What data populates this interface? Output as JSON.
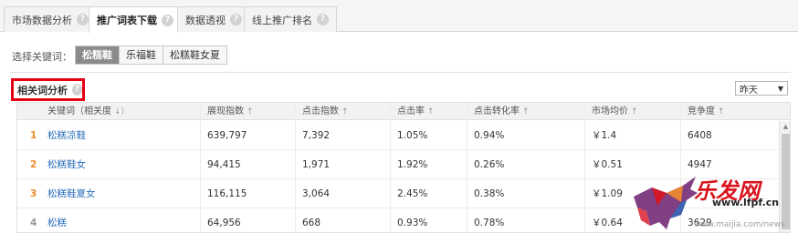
{
  "tabs": [
    {
      "label": "市场数据分析",
      "active": false
    },
    {
      "label": "推广词表下载",
      "active": true
    },
    {
      "label": "数据透视",
      "active": false
    },
    {
      "label": "线上推广排名",
      "active": false
    }
  ],
  "help_glyph": "?",
  "keyword_selector": {
    "label": "选择关键词：",
    "options": [
      "松糕鞋",
      "乐福鞋",
      "松糕鞋女夏"
    ],
    "selected": "松糕鞋"
  },
  "section": {
    "title": "相关词分析"
  },
  "date_select": {
    "value": "昨天",
    "arrow": "▼"
  },
  "table": {
    "columns": [
      {
        "label": "关键词（相关度",
        "sort": "↓）"
      },
      {
        "label": "展现指数",
        "sort": "↑"
      },
      {
        "label": "点击指数",
        "sort": "↑"
      },
      {
        "label": "点击率",
        "sort": "↑"
      },
      {
        "label": "点击转化率",
        "sort": "↑"
      },
      {
        "label": "市场均价",
        "sort": "↑"
      },
      {
        "label": "竞争度",
        "sort": "↑"
      }
    ],
    "rows": [
      {
        "rank": "1",
        "keyword": "松糕凉鞋",
        "impressions": "639,797",
        "clicks": "7,392",
        "ctr": "1.05%",
        "cvr": "0.94%",
        "price": "￥1.4",
        "competition": "6408"
      },
      {
        "rank": "2",
        "keyword": "松糕鞋女",
        "impressions": "94,415",
        "clicks": "1,971",
        "ctr": "1.92%",
        "cvr": "0.26%",
        "price": "￥0.51",
        "competition": "4947"
      },
      {
        "rank": "3",
        "keyword": "松糕鞋夏女",
        "impressions": "116,115",
        "clicks": "3,064",
        "ctr": "2.45%",
        "cvr": "0.38%",
        "price": "￥1.09",
        "competition": ""
      },
      {
        "rank": "4",
        "keyword": "松糕",
        "impressions": "64,956",
        "clicks": "668",
        "ctr": "0.93%",
        "cvr": "0.78%",
        "price": "￥0.64",
        "competition": "3629"
      }
    ]
  },
  "scrollbar": {
    "up_arrow": "▲"
  },
  "watermark": {
    "brand": "乐发网",
    "url": "www.lfpf.cn",
    "url2": "www.maijia.com/news"
  },
  "colors": {
    "rank_top": "#f08c2a",
    "rank_other": "#999999",
    "link": "#2a6ebb",
    "highlight_border": "#e60012"
  }
}
